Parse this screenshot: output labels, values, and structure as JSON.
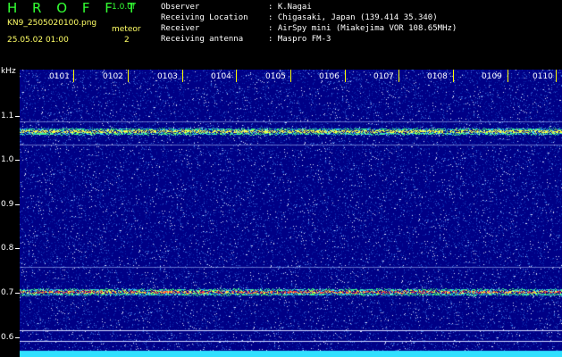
{
  "header": {
    "app_title": "H R O F F T",
    "version": "1.0.0f",
    "filename": "KN9_2505020100.png",
    "meteor_label": "meteor",
    "datetime": "25.05.02 01:00",
    "meteor_count": "2"
  },
  "info": [
    {
      "label": "Observer",
      "value": ": K.Nagai"
    },
    {
      "label": "Receiving Location",
      "value": ": Chigasaki, Japan (139.414 35.340)"
    },
    {
      "label": "Receiver",
      "value": ": AirSpy mini (Miakejima VOR 108.65MHz)"
    },
    {
      "label": "Receiving antenna",
      "value": ": Maspro FM-3"
    }
  ],
  "axes": {
    "y_unit": "kHz",
    "y_ticks": [
      "1.1",
      "1.0",
      "0.9",
      "0.8",
      "0.7",
      "0.6"
    ],
    "x_ticks": [
      "0101",
      "0102",
      "0103",
      "0104",
      "0105",
      "0106",
      "0107",
      "0108",
      "0109",
      "0110"
    ]
  },
  "colors": {
    "background": "#000000",
    "waterfall": "#000086",
    "title_green": "#33ff33",
    "label_yellow": "#ffff66",
    "tick_yellow": "#ffff00"
  }
}
